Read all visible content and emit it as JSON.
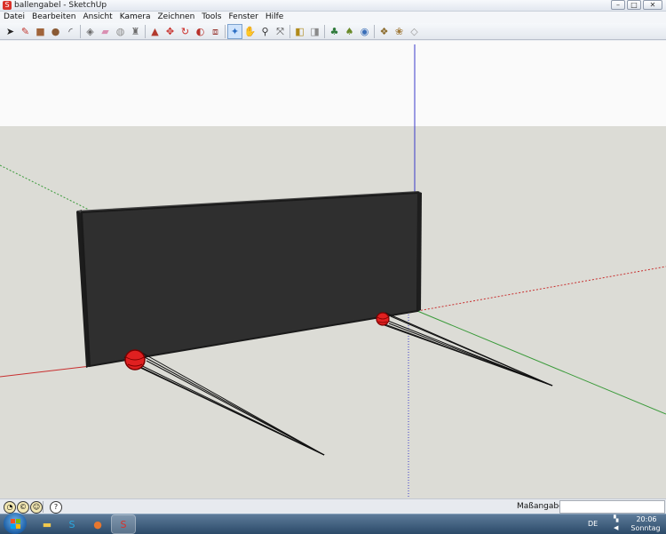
{
  "window": {
    "title": "ballengabel - SketchUp",
    "app_icon_glyph": "S",
    "buttons": [
      {
        "name": "minimize-button",
        "glyph": "–"
      },
      {
        "name": "maximize-button",
        "glyph": "□"
      },
      {
        "name": "close-button",
        "glyph": "✕"
      }
    ]
  },
  "menu": [
    "Datei",
    "Bearbeiten",
    "Ansicht",
    "Kamera",
    "Zeichnen",
    "Tools",
    "Fenster",
    "Hilfe"
  ],
  "toolbar": {
    "groups": [
      [
        {
          "icon": "select-arrow-icon",
          "glyph": "➤",
          "color": "#222222"
        },
        {
          "icon": "pencil-line-icon",
          "glyph": "✎",
          "color": "#c0342c"
        },
        {
          "icon": "rectangle-icon",
          "glyph": "■",
          "color": "#a0643a"
        },
        {
          "icon": "circle-icon",
          "glyph": "●",
          "color": "#8a5a34"
        },
        {
          "icon": "arc-icon",
          "glyph": "◜",
          "color": "#333333"
        }
      ],
      [
        {
          "icon": "make-component-icon",
          "glyph": "◈",
          "color": "#6a6a6a"
        },
        {
          "icon": "eraser-icon",
          "glyph": "▰",
          "color": "#d98fb2"
        },
        {
          "icon": "tape-measure-icon",
          "glyph": "◍",
          "color": "#8c8c8c"
        },
        {
          "icon": "paint-bucket-icon",
          "glyph": "♜",
          "color": "#6d6d6d"
        }
      ],
      [
        {
          "icon": "push-pull-icon",
          "glyph": "▲",
          "color": "#b23a2e"
        },
        {
          "icon": "move-icon",
          "glyph": "✥",
          "color": "#c8302b"
        },
        {
          "icon": "rotate-icon",
          "glyph": "↻",
          "color": "#cc2b25"
        },
        {
          "icon": "follow-me-icon",
          "glyph": "◐",
          "color": "#b8312b"
        },
        {
          "icon": "offset-icon",
          "glyph": "⧈",
          "color": "#9a3a34"
        }
      ],
      [
        {
          "icon": "orbit-icon",
          "glyph": "✦",
          "color": "#2e6fc4",
          "selected": true
        },
        {
          "icon": "pan-hand-icon",
          "glyph": "✋",
          "color": "#444444"
        },
        {
          "icon": "zoom-icon",
          "glyph": "⚲",
          "color": "#333333"
        },
        {
          "icon": "zoom-extents-icon",
          "glyph": "⤧",
          "color": "#333333"
        }
      ],
      [
        {
          "icon": "previous-view-icon",
          "glyph": "◧",
          "color": "#b08a1a"
        },
        {
          "icon": "next-view-icon",
          "glyph": "◨",
          "color": "#8a8a8a"
        }
      ],
      [
        {
          "icon": "get-models-icon",
          "glyph": "♣",
          "color": "#2f7a3a"
        },
        {
          "icon": "share-model-icon",
          "glyph": "♠",
          "color": "#6a8a2a"
        },
        {
          "icon": "google-earth-icon",
          "glyph": "◉",
          "color": "#3b6fb8"
        }
      ],
      [
        {
          "icon": "components-icon",
          "glyph": "❖",
          "color": "#8a6a2a"
        },
        {
          "icon": "materials-icon",
          "glyph": "❀",
          "color": "#a07a3a"
        },
        {
          "icon": "styles-icon",
          "glyph": "◇",
          "color": "#9a9a9a"
        }
      ]
    ]
  },
  "statusbar": {
    "icons": [
      {
        "name": "geo-location-icon",
        "glyph": "◔"
      },
      {
        "name": "credits-icon",
        "glyph": "©"
      },
      {
        "name": "user-icon",
        "glyph": "☺"
      },
      {
        "name": "help-icon",
        "glyph": "?"
      }
    ],
    "measurements_label": "Maßangaben",
    "measurements_value": ""
  },
  "taskbar": {
    "buttons": [
      {
        "name": "explorer-taskbar-button",
        "glyph": "▬",
        "color": "#f2c94c"
      },
      {
        "name": "skype-taskbar-button",
        "glyph": "S",
        "color": "#29a8e0"
      },
      {
        "name": "firefox-taskbar-button",
        "glyph": "●",
        "color": "#e8772e"
      },
      {
        "name": "sketchup-taskbar-button",
        "glyph": "S",
        "color": "#d9322a",
        "active": true
      }
    ],
    "language": "DE",
    "time": "20:06",
    "day": "Sonntag"
  },
  "viewport": {
    "colors": {
      "sky": "#fafafa",
      "ground": "#dcdcd6",
      "wall_front": "#2f2f2f",
      "wall_edge": "#1a1a1a",
      "ball": "#e02020",
      "axis_red": "#c83030",
      "axis_green": "#3a9a3a",
      "axis_blue": "#3a3aca"
    }
  }
}
